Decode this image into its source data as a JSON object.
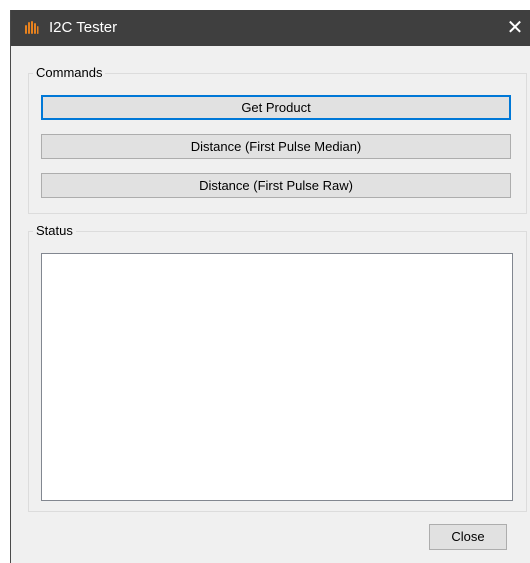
{
  "window": {
    "title": "I2C Tester",
    "close_glyph": "✕"
  },
  "commands": {
    "legend": "Commands",
    "buttons": [
      {
        "label": "Get Product"
      },
      {
        "label": "Distance (First Pulse Median)"
      },
      {
        "label": "Distance (First Pulse Raw)"
      }
    ]
  },
  "status": {
    "legend": "Status",
    "value": ""
  },
  "footer": {
    "close_label": "Close"
  },
  "colors": {
    "titlebar": "#3f3f3f",
    "accent_focus": "#0078d7",
    "icon_orange": "#e8821e"
  },
  "icons": {
    "app": "flame-icon",
    "close": "close-icon"
  }
}
